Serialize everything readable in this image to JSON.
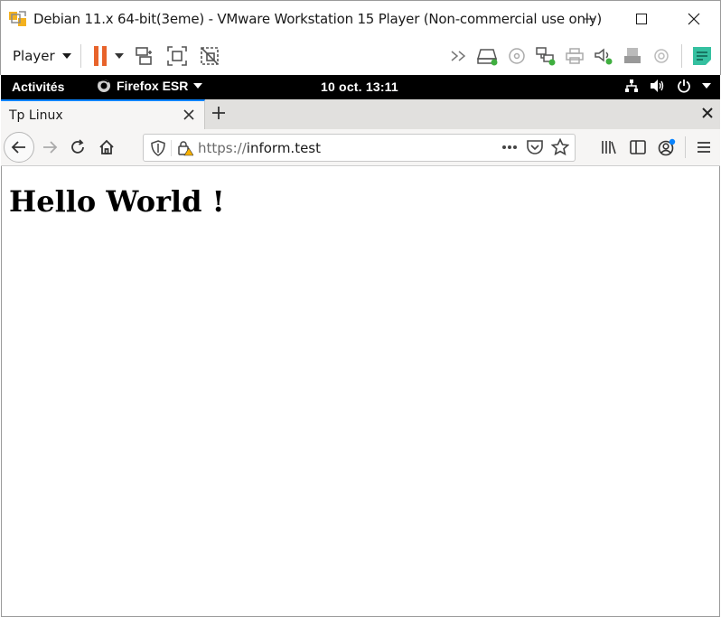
{
  "window": {
    "title": "Debian 11.x 64-bit(3eme) - VMware Workstation 15 Player (Non-commercial use only)",
    "controls": [
      "minimize-icon",
      "maximize-icon",
      "close-icon"
    ]
  },
  "vmware_toolbar": {
    "player_label": "Player",
    "accent_color": "#e8632b",
    "left_icons": [
      "pause-icon",
      "dropdown-caret-icon",
      "send-ctrl-alt-del-icon",
      "fullscreen-icon",
      "unity-icon"
    ],
    "device_icons": [
      "more-devices-icon",
      "hard-disk-icon",
      "cd-dvd-icon",
      "network-adapter-icon",
      "printer-icon",
      "sound-card-icon",
      "usb-icon",
      "camera-icon",
      "notes-icon"
    ]
  },
  "gnome": {
    "activities": "Activités",
    "app_name": "Firefox ESR",
    "clock": "10 oct.  13:11",
    "tray_icons": [
      "network-icon",
      "volume-icon",
      "power-icon",
      "menu-caret-icon"
    ]
  },
  "firefox": {
    "tab_title": "Tp Linux",
    "url_scheme": "https://",
    "url_host": "inform.test",
    "accent_color": "#0a84ff",
    "nav_icons": [
      "back-icon",
      "forward-icon",
      "reload-icon",
      "home-icon"
    ],
    "url_icons": [
      "tracking-shield-icon",
      "insecure-lock-icon",
      "page-actions-icon",
      "pocket-icon",
      "bookmark-star-icon"
    ],
    "toolbar_icons": [
      "library-icon",
      "sidebar-icon",
      "account-icon",
      "hamburger-menu-icon"
    ]
  },
  "page": {
    "heading": "Hello World !"
  }
}
